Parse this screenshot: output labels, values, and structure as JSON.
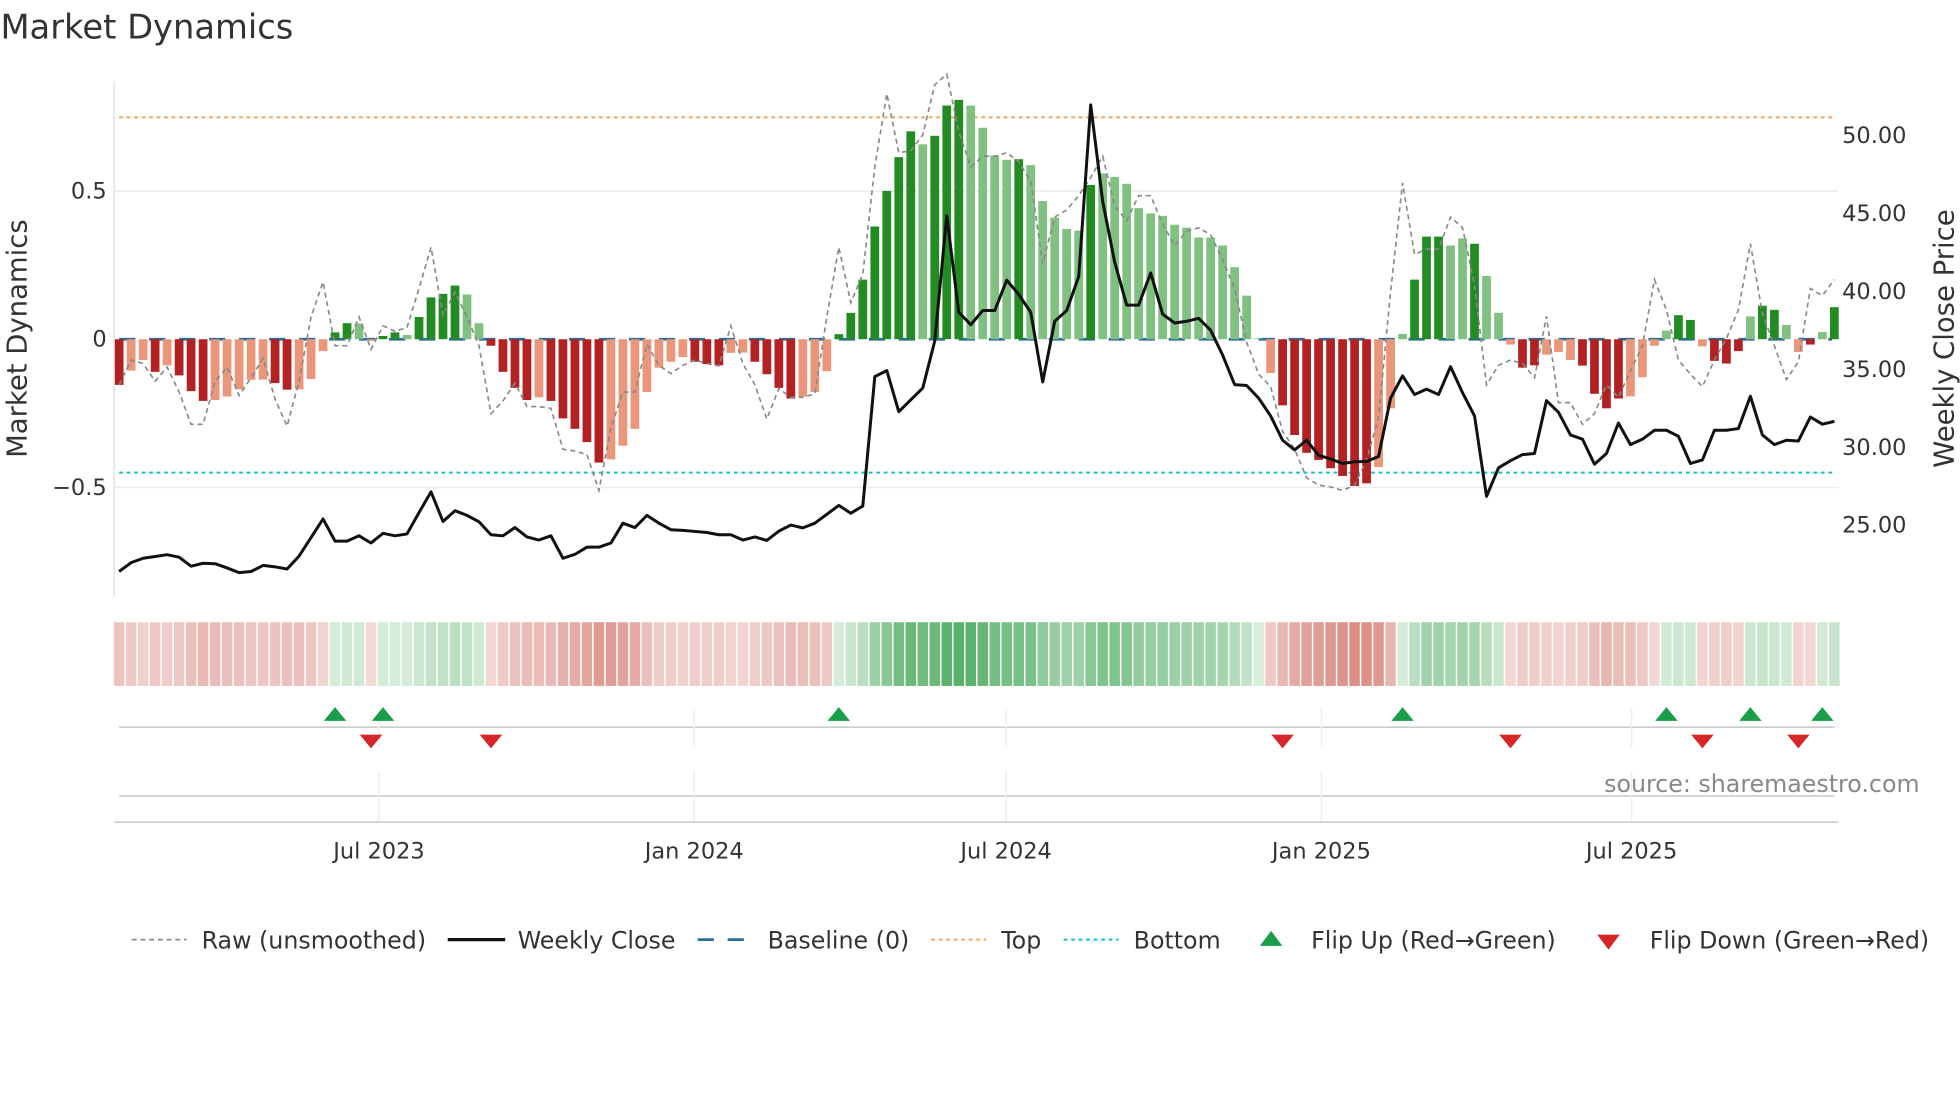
{
  "chart_data": {
    "type": "bar",
    "title": "Market Dynamics",
    "ylabel": "Market Dynamics",
    "y2label": "Weekly Close Price",
    "ylim": [
      -0.87,
      0.87
    ],
    "y2lim": [
      20.3,
      53.4
    ],
    "grid": "horizontal",
    "legend_position": "bottom",
    "source": "source: sharemaestro.com",
    "colors": {
      "bar_up_strong": "#228b22",
      "bar_up_weak": "#80c080",
      "bar_down_strong": "#b22222",
      "bar_down_weak": "#e9967a",
      "raw": "#888888",
      "close": "#111111",
      "baseline": "#2b6c9a",
      "top": "#f4a460",
      "bottom": "#17becf",
      "flip_up": "#1a9e4a",
      "flip_down": "#d62728",
      "strip_up": "#2e9e44",
      "strip_down": "#c0392b"
    },
    "left_ticks": [
      {
        "value": 0.5,
        "label": "0.5"
      },
      {
        "value": 0,
        "label": "0"
      },
      {
        "value": -0.5,
        "label": "−0.5"
      }
    ],
    "right_ticks": [
      {
        "value": 50,
        "label": "50.00"
      },
      {
        "value": 45,
        "label": "45.00"
      },
      {
        "value": 40,
        "label": "40.00"
      },
      {
        "value": 35,
        "label": "35.00"
      },
      {
        "value": 30,
        "label": "30.00"
      },
      {
        "value": 25,
        "label": "25.00"
      }
    ],
    "x_ticks": [
      {
        "date": "2023-07-01",
        "label": "Jul 2023"
      },
      {
        "date": "2024-01-01",
        "label": "Jan 2024"
      },
      {
        "date": "2024-07-01",
        "label": "Jul 2024"
      },
      {
        "date": "2025-01-01",
        "label": "Jan 2025"
      },
      {
        "date": "2025-07-01",
        "label": "Jul 2025"
      }
    ],
    "top_level": 0.748,
    "bottom_level": -0.45,
    "baseline": 0,
    "legend": [
      {
        "key": "raw",
        "label": "Raw (unsmoothed)"
      },
      {
        "key": "close",
        "label": "Weekly Close"
      },
      {
        "key": "baseline",
        "label": "Baseline (0)"
      },
      {
        "key": "top",
        "label": "Top"
      },
      {
        "key": "bottom",
        "label": "Bottom"
      },
      {
        "key": "flip_up",
        "label": "Flip Up (Red→Green)"
      },
      {
        "key": "flip_down",
        "label": "Flip Down (Green→Red)"
      }
    ],
    "dates": [
      "2023-02-03",
      "2023-02-10",
      "2023-02-17",
      "2023-02-24",
      "2023-03-03",
      "2023-03-10",
      "2023-03-17",
      "2023-03-24",
      "2023-03-31",
      "2023-04-07",
      "2023-04-14",
      "2023-04-21",
      "2023-04-28",
      "2023-05-05",
      "2023-05-12",
      "2023-05-19",
      "2023-05-26",
      "2023-06-02",
      "2023-06-09",
      "2023-06-16",
      "2023-06-23",
      "2023-06-30",
      "2023-07-07",
      "2023-07-14",
      "2023-07-21",
      "2023-07-28",
      "2023-08-04",
      "2023-08-11",
      "2023-08-18",
      "2023-08-25",
      "2023-09-01",
      "2023-09-08",
      "2023-09-15",
      "2023-09-22",
      "2023-09-29",
      "2023-10-06",
      "2023-10-13",
      "2023-10-20",
      "2023-10-27",
      "2023-11-03",
      "2023-11-10",
      "2023-11-17",
      "2023-11-24",
      "2023-12-01",
      "2023-12-08",
      "2023-12-15",
      "2023-12-22",
      "2023-12-29",
      "2024-01-05",
      "2024-01-12",
      "2024-01-19",
      "2024-01-26",
      "2024-02-02",
      "2024-02-09",
      "2024-02-16",
      "2024-02-23",
      "2024-03-01",
      "2024-03-08",
      "2024-03-15",
      "2024-03-22",
      "2024-03-29",
      "2024-04-05",
      "2024-04-12",
      "2024-04-19",
      "2024-04-26",
      "2024-05-03",
      "2024-05-10",
      "2024-05-17",
      "2024-05-24",
      "2024-05-31",
      "2024-06-07",
      "2024-06-14",
      "2024-06-21",
      "2024-06-28",
      "2024-07-05",
      "2024-07-12",
      "2024-07-19",
      "2024-07-26",
      "2024-08-02",
      "2024-08-09",
      "2024-08-16",
      "2024-08-23",
      "2024-08-30",
      "2024-09-06",
      "2024-09-13",
      "2024-09-20",
      "2024-09-27",
      "2024-10-04",
      "2024-10-11",
      "2024-10-18",
      "2024-10-25",
      "2024-11-01",
      "2024-11-08",
      "2024-11-15",
      "2024-11-22",
      "2024-11-29",
      "2024-12-06",
      "2024-12-13",
      "2024-12-20",
      "2024-12-27",
      "2025-01-03",
      "2025-01-10",
      "2025-01-17",
      "2025-01-24",
      "2025-01-31",
      "2025-02-07",
      "2025-02-14",
      "2025-02-21",
      "2025-02-28",
      "2025-03-07",
      "2025-03-14",
      "2025-03-21",
      "2025-03-28",
      "2025-04-04",
      "2025-04-11",
      "2025-04-18",
      "2025-04-25",
      "2025-05-02",
      "2025-05-09",
      "2025-05-16",
      "2025-05-23",
      "2025-05-30",
      "2025-06-06",
      "2025-06-13",
      "2025-06-20",
      "2025-06-27",
      "2025-07-04",
      "2025-07-11",
      "2025-07-18",
      "2025-07-25",
      "2025-08-01",
      "2025-08-08",
      "2025-08-15",
      "2025-08-22",
      "2025-08-29",
      "2025-09-05",
      "2025-09-12",
      "2025-09-19",
      "2025-09-26",
      "2025-10-03",
      "2025-10-10",
      "2025-10-17",
      "2025-10-24",
      "2025-10-31"
    ],
    "dynamics": [
      -0.154,
      -0.106,
      -0.07,
      -0.11,
      -0.088,
      -0.122,
      -0.175,
      -0.208,
      -0.205,
      -0.193,
      -0.169,
      -0.137,
      -0.136,
      -0.148,
      -0.17,
      -0.169,
      -0.134,
      -0.04,
      0.023,
      0.054,
      0.053,
      -0.005,
      0.011,
      0.023,
      0.014,
      0.075,
      0.141,
      0.153,
      0.181,
      0.151,
      0.054,
      -0.022,
      -0.11,
      -0.164,
      -0.205,
      -0.196,
      -0.208,
      -0.267,
      -0.302,
      -0.347,
      -0.416,
      -0.405,
      -0.359,
      -0.302,
      -0.178,
      -0.096,
      -0.076,
      -0.06,
      -0.076,
      -0.084,
      -0.088,
      -0.046,
      -0.045,
      -0.076,
      -0.118,
      -0.164,
      -0.2,
      -0.193,
      -0.178,
      -0.108,
      0.017,
      0.089,
      0.201,
      0.38,
      0.5,
      0.614,
      0.701,
      0.657,
      0.686,
      0.788,
      0.807,
      0.788,
      0.713,
      0.619,
      0.605,
      0.607,
      0.587,
      0.466,
      0.41,
      0.372,
      0.366,
      0.52,
      0.559,
      0.547,
      0.524,
      0.442,
      0.424,
      0.416,
      0.386,
      0.376,
      0.343,
      0.343,
      0.316,
      0.243,
      0.147,
      0.003,
      -0.114,
      -0.223,
      -0.323,
      -0.383,
      -0.407,
      -0.435,
      -0.461,
      -0.495,
      -0.486,
      -0.431,
      -0.233,
      0.018,
      0.201,
      0.346,
      0.346,
      0.316,
      0.34,
      0.322,
      0.213,
      0.089,
      -0.018,
      -0.096,
      -0.088,
      -0.052,
      -0.043,
      -0.07,
      -0.089,
      -0.184,
      -0.233,
      -0.2,
      -0.193,
      -0.128,
      -0.022,
      0.029,
      0.081,
      0.065,
      -0.024,
      -0.073,
      -0.082,
      -0.04,
      0.077,
      0.113,
      0.099,
      0.048,
      -0.043,
      -0.018,
      0.024,
      0.108
    ],
    "bar_strength": "DLLDLDDDLLLLLDDLLLDDLLDDLDDDDLLDDDDLDDDDDLLLLLLLDDDLLDDDDLLLDDDDDDDLDDDLLLLDLLLLLDLLLLLLLLLLLLLLLDDDDDDDDLLLDDDLLDLLLDDLLLDDDDLLLLDDLDDDLDDLLDLDD",
    "raw": [
      -0.154,
      -0.07,
      -0.082,
      -0.142,
      -0.094,
      -0.178,
      -0.287,
      -0.287,
      -0.142,
      -0.094,
      -0.19,
      -0.13,
      -0.064,
      -0.202,
      -0.293,
      -0.142,
      0.075,
      0.193,
      -0.022,
      -0.022,
      0.075,
      -0.034,
      0.045,
      0.027,
      0.039,
      0.171,
      0.31,
      0.081,
      0.159,
      0.075,
      -0.022,
      -0.251,
      -0.208,
      -0.148,
      -0.227,
      -0.227,
      -0.233,
      -0.371,
      -0.377,
      -0.389,
      -0.51,
      -0.299,
      -0.178,
      -0.178,
      -0.016,
      -0.088,
      -0.116,
      -0.088,
      -0.07,
      -0.082,
      -0.09,
      0.045,
      -0.082,
      -0.154,
      -0.269,
      -0.166,
      -0.196,
      -0.196,
      -0.184,
      0.075,
      0.31,
      0.123,
      0.219,
      0.581,
      0.828,
      0.629,
      0.635,
      0.689,
      0.858,
      0.894,
      0.701,
      0.581,
      0.617,
      0.617,
      0.629,
      0.599,
      0.533,
      0.255,
      0.412,
      0.436,
      0.484,
      0.545,
      0.617,
      0.448,
      0.4,
      0.484,
      0.484,
      0.388,
      0.316,
      0.364,
      0.376,
      0.352,
      0.267,
      0.171,
      -0.01,
      -0.118,
      -0.16,
      -0.311,
      -0.371,
      -0.467,
      -0.492,
      -0.498,
      -0.51,
      -0.492,
      -0.407,
      -0.263,
      0.159,
      0.527,
      0.286,
      0.304,
      0.304,
      0.412,
      0.376,
      0.183,
      -0.154,
      -0.088,
      -0.07,
      -0.082,
      -0.13,
      0.077,
      -0.214,
      -0.214,
      -0.287,
      -0.251,
      -0.154,
      -0.196,
      -0.106,
      -0.022,
      0.201,
      0.099,
      -0.07,
      -0.118,
      -0.16,
      -0.07,
      0.002,
      0.099,
      0.322,
      0.087,
      -0.022,
      -0.136,
      -0.076,
      0.171,
      0.147,
      0.201
    ],
    "close": [
      21.95,
      22.52,
      22.8,
      22.91,
      23.03,
      22.87,
      22.29,
      22.48,
      22.45,
      22.18,
      21.88,
      21.95,
      22.34,
      22.25,
      22.11,
      22.94,
      24.13,
      25.32,
      23.9,
      23.9,
      24.24,
      23.78,
      24.4,
      24.24,
      24.36,
      25.73,
      27.06,
      25.16,
      25.85,
      25.55,
      25.14,
      24.31,
      24.24,
      24.77,
      24.17,
      23.97,
      24.24,
      22.8,
      23.05,
      23.51,
      23.51,
      23.78,
      25.05,
      24.77,
      25.55,
      25.05,
      24.63,
      24.59,
      24.52,
      24.45,
      24.31,
      24.31,
      23.97,
      24.17,
      23.94,
      24.54,
      24.93,
      24.75,
      25.05,
      25.62,
      26.19,
      25.69,
      26.15,
      34.45,
      34.84,
      32.2,
      32.96,
      33.72,
      36.74,
      44.77,
      38.58,
      37.78,
      38.69,
      38.69,
      40.64,
      39.72,
      38.58,
      34.11,
      38.0,
      38.69,
      40.87,
      51.88,
      45.69,
      41.79,
      39.04,
      39.04,
      41.1,
      38.46,
      37.89,
      38.0,
      38.19,
      37.43,
      35.83,
      33.94,
      33.88,
      33.07,
      31.93,
      30.37,
      29.75,
      30.37,
      29.4,
      29.17,
      28.88,
      28.99,
      29.01,
      29.33,
      33.07,
      34.5,
      33.3,
      33.65,
      33.3,
      35.09,
      33.42,
      31.93,
      26.77,
      28.6,
      29.06,
      29.45,
      29.52,
      32.91,
      32.16,
      30.71,
      30.44,
      28.83,
      29.52,
      31.47,
      30.09,
      30.44,
      31.01,
      31.01,
      30.62,
      28.88,
      29.11,
      31.01,
      31.01,
      31.12,
      33.19,
      30.71,
      30.09,
      30.37,
      30.32,
      31.86,
      31.4,
      31.58
    ],
    "flip_up": [
      "2023-06-09",
      "2023-07-07",
      "2024-03-29",
      "2025-02-21",
      "2025-07-25",
      "2025-09-12",
      "2025-10-24"
    ],
    "flip_down": [
      "2023-06-30",
      "2023-09-08",
      "2024-12-13",
      "2025-04-25",
      "2025-08-15",
      "2025-10-10"
    ]
  }
}
